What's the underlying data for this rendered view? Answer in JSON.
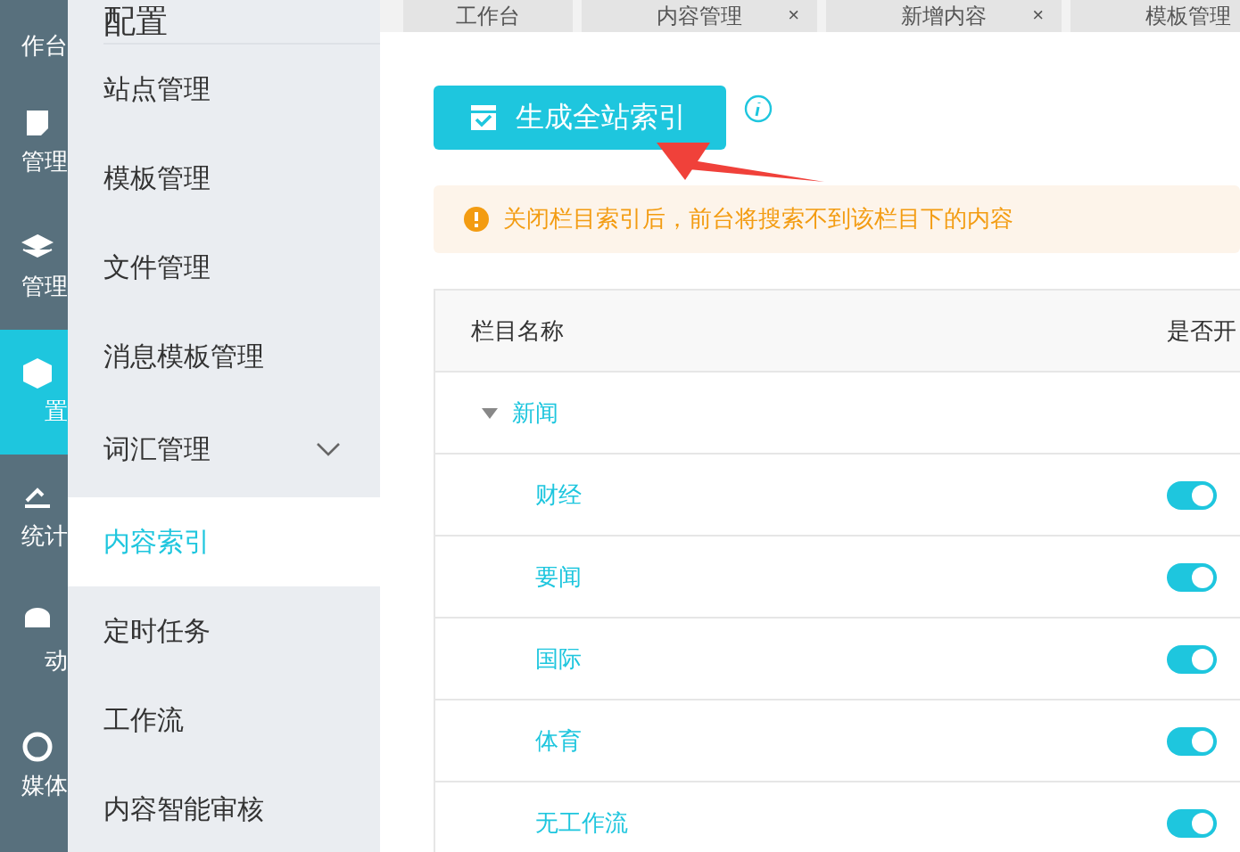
{
  "rail": [
    {
      "label": "作台",
      "selected": false
    },
    {
      "label": "管理",
      "selected": false
    },
    {
      "label": "管理",
      "selected": false
    },
    {
      "label": "置",
      "selected": true
    },
    {
      "label": "统计",
      "selected": false
    },
    {
      "label": "动",
      "selected": false
    },
    {
      "label": "媒体",
      "selected": false
    }
  ],
  "sidebar": {
    "title": "配置",
    "items": [
      {
        "label": "站点管理",
        "kind": "item",
        "selected": false
      },
      {
        "label": "模板管理",
        "kind": "item",
        "selected": false
      },
      {
        "label": "文件管理",
        "kind": "item",
        "selected": false
      },
      {
        "label": "消息模板管理",
        "kind": "item",
        "selected": false
      },
      {
        "label": "词汇管理",
        "kind": "group",
        "selected": false
      },
      {
        "label": "内容索引",
        "kind": "item",
        "selected": true
      },
      {
        "label": "定时任务",
        "kind": "item",
        "selected": false
      },
      {
        "label": "工作流",
        "kind": "item",
        "selected": false
      },
      {
        "label": "内容智能审核",
        "kind": "item",
        "selected": false
      }
    ]
  },
  "tabs": [
    {
      "label": "工作台"
    },
    {
      "label": "内容管理",
      "close": "×"
    },
    {
      "label": "新增内容",
      "close": "×"
    },
    {
      "label": "模板管理"
    }
  ],
  "generate_button": "生成全站索引",
  "notice": "关闭栏目索引后，前台将搜索不到该栏目下的内容",
  "table": {
    "columns": [
      "栏目名称",
      "是否开"
    ],
    "rows": [
      {
        "name": "新闻",
        "expanded": true,
        "children": [
          {
            "name": "财经",
            "on": true
          },
          {
            "name": "要闻",
            "on": true
          },
          {
            "name": "国际",
            "on": true
          },
          {
            "name": "体育",
            "on": true
          },
          {
            "name": "无工作流",
            "on": true
          }
        ]
      }
    ]
  }
}
